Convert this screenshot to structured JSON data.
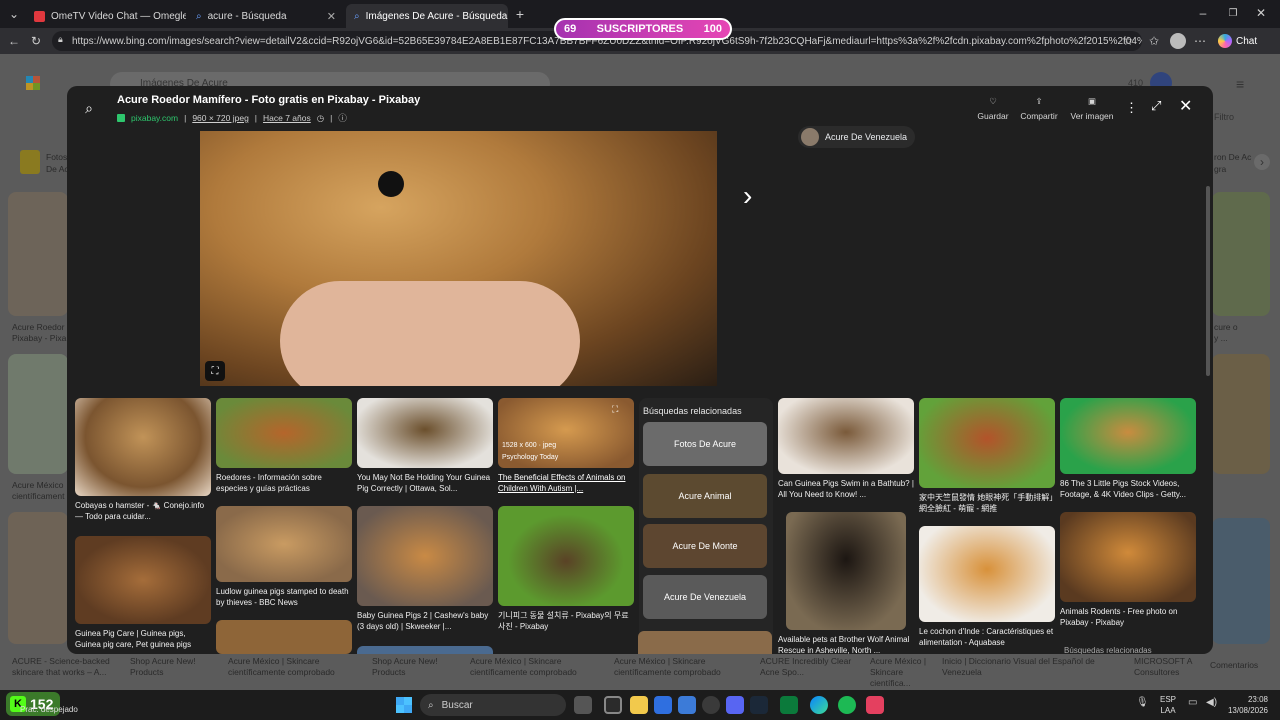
{
  "tabs": [
    {
      "title": "OmeTV Video Chat — Omegle",
      "favicon_color": "#e0383e"
    },
    {
      "title": "acure - Búsqueda",
      "favicon_color": "#3b82f6"
    },
    {
      "title": "Imágenes De Acure - Búsqueda Im",
      "favicon_color": "#3b82f6"
    }
  ],
  "url": "https://www.bing.com/images/search?view=detailV2&ccid=R92ojVG6&id=52B65E39784E2A8EB1E87FC13A7BB7BFF6ZU0DZZ&thid=OIP.R92ojVG6tS9h-7f2b23CQHaFj&mediaurl=https%3a%2f%2fcdn.pixabay.com%2fphoto%2f2015%2f04%2f27%2f16%2f...",
  "overlay": {
    "left_count": "69",
    "label": "SUSCRIPTORES",
    "right_count": "100"
  },
  "chat_label": "Chat",
  "bg": {
    "search_text": "Imágenes De Acure",
    "count": "410",
    "filter_label": "Filtro",
    "left_caps": [
      "Acure Roedor",
      "Pixabay - Pixa",
      "Acure México",
      "científicament"
    ],
    "right_caps": [
      "cure o",
      "y ...",
      "ron De Ac",
      "gra"
    ],
    "strip_left": "Fotos",
    "strip_left2": "De Ac"
  },
  "modal": {
    "title": "Acure Roedor Mamífero - Foto gratis en Pixabay - Pixabay",
    "source": "pixabay.com",
    "dims": "960 × 720 jpeg",
    "age": "Hace 7 años",
    "actions": [
      "Guardar",
      "Compartir",
      "Ver imagen"
    ],
    "suggestion_chip": "Acure De Venezuela",
    "related_title": "Búsquedas relacionadas",
    "related": [
      "Fotos De Acure",
      "Acure Animal",
      "Acure De Monte",
      "Acure De Venezuela"
    ],
    "hover_meta": "1528 x 600 · jpeg",
    "hover_source": "Psychology Today",
    "captions": [
      "Cobayas o hamster - 🐁 Conejo.info — Todo para cuidar...",
      "Guinea Pig Care | Guinea pigs, Guinea pig care, Pet guinea pigs",
      "Roedores - Información sobre especies y guías prácticas",
      "Ludlow guinea pigs stamped to death by thieves - BBC News",
      "You May Not Be Holding Your Guinea Pig Correctly | Ottawa, Sol...",
      "Baby Guinea Pigs 2 | Cashew's baby (3 days old) | Skweeker |...",
      "The Beneficial Effects of Animals on Children With Autism |...",
      "기니피그 동물 설치류 - Pixabay의 무료 사진 - Pixabay",
      "Can Guinea Pigs Swim in a Bathtub? | All You Need to Know! ...",
      "Available pets at Brother Wolf Animal Rescue in Asheville, North ...",
      "家中天竺鼠發情 她眼神死「手動排解」網全臉紅 - 萌寵 - 網推",
      "Le cochon d'Inde : Caractéristiques et alimentation - Aquabase",
      "86 The 3 Little Pigs Stock Videos, Footage, & 4K Video Clips - Getty...",
      "Animals Rodents - Free photo on Pixabay - Pixabay",
      "Búsquedas relacionadas"
    ]
  },
  "bottom_captions": [
    "ACURE - Science-backed skincare that works – A...",
    "Shop Acure New! Products",
    "Acure México | Skincare científicamente comprobado",
    "Shop Acure New! Products",
    "Acure México | Skincare científicamente comprobado",
    "Acure México | Skincare científicamente comprobado",
    "ACURE Incredibly Clear Acne Spo...",
    "Acure México | Skincare científica...",
    "Inicio | Diccionario Visual del Español de Venezuela",
    "MICROSOFT A Consultores",
    "Comentarios"
  ],
  "taskbar": {
    "widget_count": "152",
    "weather": "Prac. despejado",
    "search": "Buscar",
    "lang1": "ESP",
    "lang2": "LAA",
    "time": "23:08",
    "date": "13/08/2026"
  },
  "colors": {
    "accent": "#7fbfff",
    "overlay_pink": "#d63dc4",
    "guinea_tan": "#b07a3c"
  }
}
